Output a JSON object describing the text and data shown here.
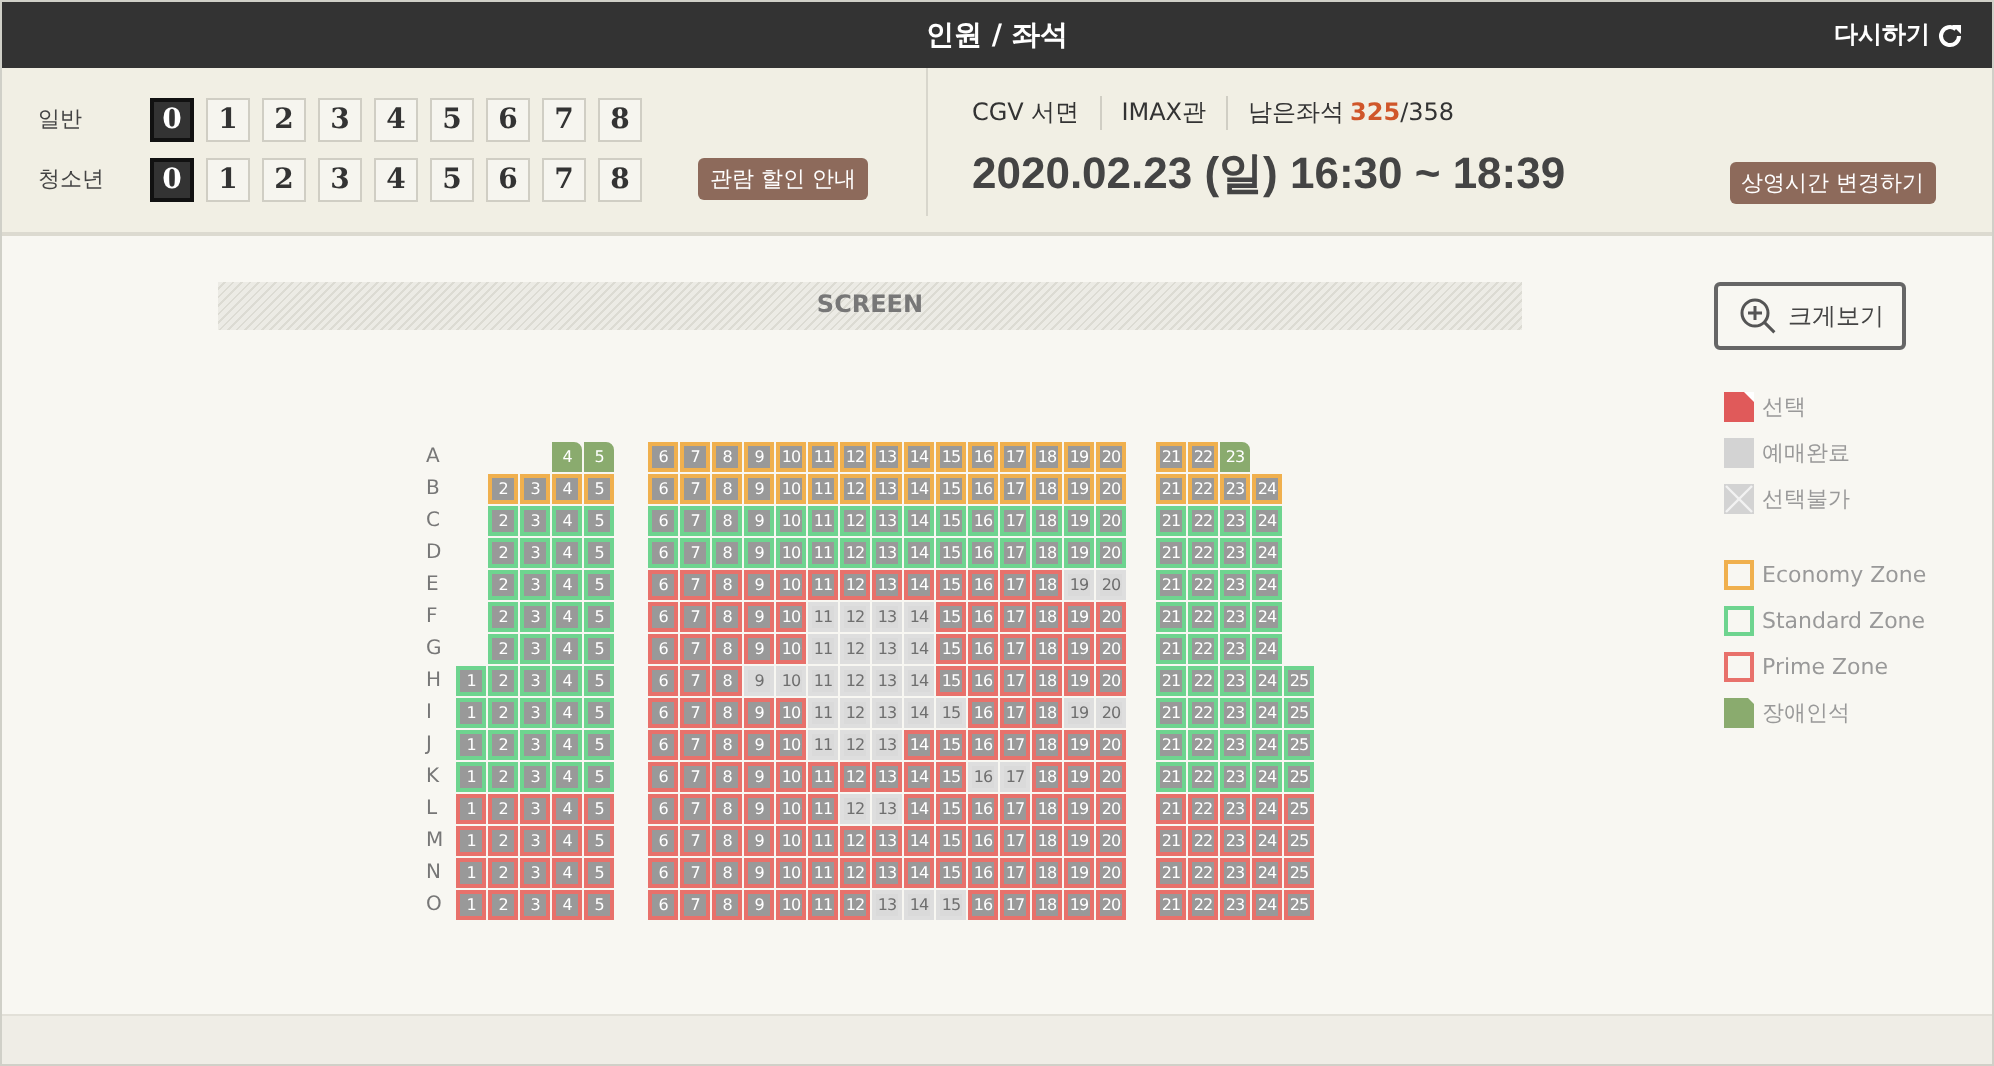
{
  "header": {
    "title": "인원 / 좌석",
    "reset_label": "다시하기"
  },
  "people": [
    {
      "label": "일반",
      "options": [
        {
          "label": "0",
          "selected": true
        },
        {
          "label": "1",
          "selected": false
        },
        {
          "label": "2",
          "selected": false
        },
        {
          "label": "3",
          "selected": false
        },
        {
          "label": "4",
          "selected": false
        },
        {
          "label": "5",
          "selected": false
        },
        {
          "label": "6",
          "selected": false
        },
        {
          "label": "7",
          "selected": false
        },
        {
          "label": "8",
          "selected": false
        }
      ]
    },
    {
      "label": "청소년",
      "options": [
        {
          "label": "0",
          "selected": true
        },
        {
          "label": "1",
          "selected": false
        },
        {
          "label": "2",
          "selected": false
        },
        {
          "label": "3",
          "selected": false
        },
        {
          "label": "4",
          "selected": false
        },
        {
          "label": "5",
          "selected": false
        },
        {
          "label": "6",
          "selected": false
        },
        {
          "label": "7",
          "selected": false
        },
        {
          "label": "8",
          "selected": false
        }
      ]
    }
  ],
  "discount_button": "관람 할인 안내",
  "showing": {
    "theater": "CGV 서면",
    "hall": "IMAX관",
    "remaining_label": "남은좌석",
    "remaining": "325",
    "total": "/358",
    "datetime": "2020.02.23 (일) 16:30 ~ 18:39",
    "change_button": "상영시간 변경하기"
  },
  "screen_label": "SCREEN",
  "zoom_button": "크게보기",
  "legend": [
    {
      "kind": "selected",
      "label": "선택"
    },
    {
      "kind": "sold",
      "label": "예매완료"
    },
    {
      "kind": "unavailable",
      "label": "선택불가"
    },
    {
      "kind": "economy",
      "label": "Economy Zone"
    },
    {
      "kind": "standard",
      "label": "Standard Zone"
    },
    {
      "kind": "prime",
      "label": "Prime Zone"
    },
    {
      "kind": "handicap",
      "label": "장애인석"
    }
  ],
  "rows": [
    {
      "label": "A",
      "blocks": [
        {
          "kind": "handicap",
          "seats": [
            {
              "number": "4",
              "sold": false
            },
            {
              "number": "5",
              "sold": false
            }
          ]
        },
        {
          "kind": "economy",
          "seats": [
            {
              "number": "6",
              "sold": false
            },
            {
              "number": "7",
              "sold": false
            },
            {
              "number": "8",
              "sold": false
            },
            {
              "number": "9",
              "sold": false
            },
            {
              "number": "10",
              "sold": false
            },
            {
              "number": "11",
              "sold": false
            },
            {
              "number": "12",
              "sold": false
            },
            {
              "number": "13",
              "sold": false
            },
            {
              "number": "14",
              "sold": false
            },
            {
              "number": "15",
              "sold": false
            },
            {
              "number": "16",
              "sold": false
            },
            {
              "number": "17",
              "sold": false
            },
            {
              "number": "18",
              "sold": false
            },
            {
              "number": "19",
              "sold": false
            },
            {
              "number": "20",
              "sold": false
            }
          ]
        },
        {
          "kind": "economy",
          "seats": [
            {
              "number": "21",
              "sold": false,
              "kind": "regular"
            },
            {
              "number": "22",
              "sold": false,
              "kind": "regular"
            },
            {
              "number": "23",
              "sold": false,
              "kind": "handicap"
            }
          ]
        }
      ]
    },
    {
      "label": "B",
      "blocks": [
        {
          "kind": "economy",
          "seats": [
            {
              "number": "2",
              "sold": false
            },
            {
              "number": "3",
              "sold": false
            },
            {
              "number": "4",
              "sold": false
            },
            {
              "number": "5",
              "sold": false
            }
          ]
        },
        {
          "kind": "economy",
          "seats": [
            {
              "number": "6",
              "sold": false
            },
            {
              "number": "7",
              "sold": false
            },
            {
              "number": "8",
              "sold": false
            },
            {
              "number": "9",
              "sold": false
            },
            {
              "number": "10",
              "sold": false
            },
            {
              "number": "11",
              "sold": false
            },
            {
              "number": "12",
              "sold": false
            },
            {
              "number": "13",
              "sold": false
            },
            {
              "number": "14",
              "sold": false
            },
            {
              "number": "15",
              "sold": false
            },
            {
              "number": "16",
              "sold": false
            },
            {
              "number": "17",
              "sold": false
            },
            {
              "number": "18",
              "sold": false
            },
            {
              "number": "19",
              "sold": false
            },
            {
              "number": "20",
              "sold": false
            }
          ]
        },
        {
          "kind": "economy",
          "seats": [
            {
              "number": "21",
              "sold": false
            },
            {
              "number": "22",
              "sold": false
            },
            {
              "number": "23",
              "sold": false
            },
            {
              "number": "24",
              "sold": false
            }
          ]
        }
      ]
    },
    {
      "label": "C",
      "blocks": [
        {
          "kind": "standard",
          "seats": [
            {
              "number": "2",
              "sold": false
            },
            {
              "number": "3",
              "sold": false
            },
            {
              "number": "4",
              "sold": false
            },
            {
              "number": "5",
              "sold": false
            }
          ]
        },
        {
          "kind": "standard",
          "seats": [
            {
              "number": "6",
              "sold": false
            },
            {
              "number": "7",
              "sold": false
            },
            {
              "number": "8",
              "sold": false
            },
            {
              "number": "9",
              "sold": false
            },
            {
              "number": "10",
              "sold": false
            },
            {
              "number": "11",
              "sold": false
            },
            {
              "number": "12",
              "sold": false
            },
            {
              "number": "13",
              "sold": false
            },
            {
              "number": "14",
              "sold": false
            },
            {
              "number": "15",
              "sold": false
            },
            {
              "number": "16",
              "sold": false
            },
            {
              "number": "17",
              "sold": false
            },
            {
              "number": "18",
              "sold": false
            },
            {
              "number": "19",
              "sold": false
            },
            {
              "number": "20",
              "sold": false
            }
          ]
        },
        {
          "kind": "standard",
          "seats": [
            {
              "number": "21",
              "sold": false
            },
            {
              "number": "22",
              "sold": false
            },
            {
              "number": "23",
              "sold": false
            },
            {
              "number": "24",
              "sold": false
            }
          ]
        }
      ]
    },
    {
      "label": "D",
      "blocks": [
        {
          "kind": "standard",
          "seats": [
            {
              "number": "2",
              "sold": false
            },
            {
              "number": "3",
              "sold": false
            },
            {
              "number": "4",
              "sold": false
            },
            {
              "number": "5",
              "sold": false
            }
          ]
        },
        {
          "kind": "standard",
          "seats": [
            {
              "number": "6",
              "sold": false
            },
            {
              "number": "7",
              "sold": false
            },
            {
              "number": "8",
              "sold": false
            },
            {
              "number": "9",
              "sold": false
            },
            {
              "number": "10",
              "sold": false
            },
            {
              "number": "11",
              "sold": false
            },
            {
              "number": "12",
              "sold": false
            },
            {
              "number": "13",
              "sold": false
            },
            {
              "number": "14",
              "sold": false
            },
            {
              "number": "15",
              "sold": false
            },
            {
              "number": "16",
              "sold": false
            },
            {
              "number": "17",
              "sold": false
            },
            {
              "number": "18",
              "sold": false
            },
            {
              "number": "19",
              "sold": false
            },
            {
              "number": "20",
              "sold": false
            }
          ]
        },
        {
          "kind": "standard",
          "seats": [
            {
              "number": "21",
              "sold": false
            },
            {
              "number": "22",
              "sold": false
            },
            {
              "number": "23",
              "sold": false
            },
            {
              "number": "24",
              "sold": false
            }
          ]
        }
      ]
    },
    {
      "label": "E",
      "blocks": [
        {
          "kind": "standard",
          "seats": [
            {
              "number": "2",
              "sold": false
            },
            {
              "number": "3",
              "sold": false
            },
            {
              "number": "4",
              "sold": false
            },
            {
              "number": "5",
              "sold": false
            }
          ]
        },
        {
          "kind": "prime",
          "seats": [
            {
              "number": "6",
              "sold": false
            },
            {
              "number": "7",
              "sold": false
            },
            {
              "number": "8",
              "sold": false
            },
            {
              "number": "9",
              "sold": false
            },
            {
              "number": "10",
              "sold": false
            },
            {
              "number": "11",
              "sold": false
            },
            {
              "number": "12",
              "sold": false
            },
            {
              "number": "13",
              "sold": false
            },
            {
              "number": "14",
              "sold": false
            },
            {
              "number": "15",
              "sold": false
            },
            {
              "number": "16",
              "sold": false
            },
            {
              "number": "17",
              "sold": false
            },
            {
              "number": "18",
              "sold": false
            },
            {
              "number": "19",
              "sold": true
            },
            {
              "number": "20",
              "sold": true
            }
          ]
        },
        {
          "kind": "standard",
          "seats": [
            {
              "number": "21",
              "sold": false
            },
            {
              "number": "22",
              "sold": false
            },
            {
              "number": "23",
              "sold": false
            },
            {
              "number": "24",
              "sold": false
            }
          ]
        }
      ]
    },
    {
      "label": "F",
      "blocks": [
        {
          "kind": "standard",
          "seats": [
            {
              "number": "2",
              "sold": false
            },
            {
              "number": "3",
              "sold": false
            },
            {
              "number": "4",
              "sold": false
            },
            {
              "number": "5",
              "sold": false
            }
          ]
        },
        {
          "kind": "prime",
          "seats": [
            {
              "number": "6",
              "sold": false
            },
            {
              "number": "7",
              "sold": false
            },
            {
              "number": "8",
              "sold": false
            },
            {
              "number": "9",
              "sold": false
            },
            {
              "number": "10",
              "sold": false
            },
            {
              "number": "11",
              "sold": true
            },
            {
              "number": "12",
              "sold": true
            },
            {
              "number": "13",
              "sold": true
            },
            {
              "number": "14",
              "sold": true
            },
            {
              "number": "15",
              "sold": false
            },
            {
              "number": "16",
              "sold": false
            },
            {
              "number": "17",
              "sold": false
            },
            {
              "number": "18",
              "sold": false
            },
            {
              "number": "19",
              "sold": false
            },
            {
              "number": "20",
              "sold": false
            }
          ]
        },
        {
          "kind": "standard",
          "seats": [
            {
              "number": "21",
              "sold": false
            },
            {
              "number": "22",
              "sold": false
            },
            {
              "number": "23",
              "sold": false
            },
            {
              "number": "24",
              "sold": false
            }
          ]
        }
      ]
    },
    {
      "label": "G",
      "blocks": [
        {
          "kind": "standard",
          "seats": [
            {
              "number": "2",
              "sold": false
            },
            {
              "number": "3",
              "sold": false
            },
            {
              "number": "4",
              "sold": false
            },
            {
              "number": "5",
              "sold": false
            }
          ]
        },
        {
          "kind": "prime",
          "seats": [
            {
              "number": "6",
              "sold": false
            },
            {
              "number": "7",
              "sold": false
            },
            {
              "number": "8",
              "sold": false
            },
            {
              "number": "9",
              "sold": false
            },
            {
              "number": "10",
              "sold": false
            },
            {
              "number": "11",
              "sold": true
            },
            {
              "number": "12",
              "sold": true
            },
            {
              "number": "13",
              "sold": true
            },
            {
              "number": "14",
              "sold": true
            },
            {
              "number": "15",
              "sold": false
            },
            {
              "number": "16",
              "sold": false
            },
            {
              "number": "17",
              "sold": false
            },
            {
              "number": "18",
              "sold": false
            },
            {
              "number": "19",
              "sold": false
            },
            {
              "number": "20",
              "sold": false
            }
          ]
        },
        {
          "kind": "standard",
          "seats": [
            {
              "number": "21",
              "sold": false
            },
            {
              "number": "22",
              "sold": false
            },
            {
              "number": "23",
              "sold": false
            },
            {
              "number": "24",
              "sold": false
            }
          ]
        }
      ]
    },
    {
      "label": "H",
      "blocks": [
        {
          "kind": "standard",
          "seats": [
            {
              "number": "1",
              "sold": false
            },
            {
              "number": "2",
              "sold": false
            },
            {
              "number": "3",
              "sold": false
            },
            {
              "number": "4",
              "sold": false
            },
            {
              "number": "5",
              "sold": false
            }
          ]
        },
        {
          "kind": "prime",
          "seats": [
            {
              "number": "6",
              "sold": false
            },
            {
              "number": "7",
              "sold": false
            },
            {
              "number": "8",
              "sold": false
            },
            {
              "number": "9",
              "sold": true
            },
            {
              "number": "10",
              "sold": true
            },
            {
              "number": "11",
              "sold": true
            },
            {
              "number": "12",
              "sold": true
            },
            {
              "number": "13",
              "sold": true
            },
            {
              "number": "14",
              "sold": true
            },
            {
              "number": "15",
              "sold": false
            },
            {
              "number": "16",
              "sold": false
            },
            {
              "number": "17",
              "sold": false
            },
            {
              "number": "18",
              "sold": false
            },
            {
              "number": "19",
              "sold": false
            },
            {
              "number": "20",
              "sold": false
            }
          ]
        },
        {
          "kind": "standard",
          "seats": [
            {
              "number": "21",
              "sold": false
            },
            {
              "number": "22",
              "sold": false
            },
            {
              "number": "23",
              "sold": false
            },
            {
              "number": "24",
              "sold": false
            },
            {
              "number": "25",
              "sold": false
            }
          ]
        }
      ]
    },
    {
      "label": "I",
      "blocks": [
        {
          "kind": "standard",
          "seats": [
            {
              "number": "1",
              "sold": false
            },
            {
              "number": "2",
              "sold": false
            },
            {
              "number": "3",
              "sold": false
            },
            {
              "number": "4",
              "sold": false
            },
            {
              "number": "5",
              "sold": false
            }
          ]
        },
        {
          "kind": "prime",
          "seats": [
            {
              "number": "6",
              "sold": false
            },
            {
              "number": "7",
              "sold": false
            },
            {
              "number": "8",
              "sold": false
            },
            {
              "number": "9",
              "sold": false
            },
            {
              "number": "10",
              "sold": false
            },
            {
              "number": "11",
              "sold": true
            },
            {
              "number": "12",
              "sold": true
            },
            {
              "number": "13",
              "sold": true
            },
            {
              "number": "14",
              "sold": true
            },
            {
              "number": "15",
              "sold": true
            },
            {
              "number": "16",
              "sold": false
            },
            {
              "number": "17",
              "sold": false
            },
            {
              "number": "18",
              "sold": false
            },
            {
              "number": "19",
              "sold": true
            },
            {
              "number": "20",
              "sold": true
            }
          ]
        },
        {
          "kind": "standard",
          "seats": [
            {
              "number": "21",
              "sold": false
            },
            {
              "number": "22",
              "sold": false
            },
            {
              "number": "23",
              "sold": false
            },
            {
              "number": "24",
              "sold": false
            },
            {
              "number": "25",
              "sold": false
            }
          ]
        }
      ]
    },
    {
      "label": "J",
      "blocks": [
        {
          "kind": "standard",
          "seats": [
            {
              "number": "1",
              "sold": false
            },
            {
              "number": "2",
              "sold": false
            },
            {
              "number": "3",
              "sold": false
            },
            {
              "number": "4",
              "sold": false
            },
            {
              "number": "5",
              "sold": false
            }
          ]
        },
        {
          "kind": "prime",
          "seats": [
            {
              "number": "6",
              "sold": false
            },
            {
              "number": "7",
              "sold": false
            },
            {
              "number": "8",
              "sold": false
            },
            {
              "number": "9",
              "sold": false
            },
            {
              "number": "10",
              "sold": false
            },
            {
              "number": "11",
              "sold": true
            },
            {
              "number": "12",
              "sold": true
            },
            {
              "number": "13",
              "sold": true
            },
            {
              "number": "14",
              "sold": false
            },
            {
              "number": "15",
              "sold": false
            },
            {
              "number": "16",
              "sold": false
            },
            {
              "number": "17",
              "sold": false
            },
            {
              "number": "18",
              "sold": false
            },
            {
              "number": "19",
              "sold": false
            },
            {
              "number": "20",
              "sold": false
            }
          ]
        },
        {
          "kind": "standard",
          "seats": [
            {
              "number": "21",
              "sold": false
            },
            {
              "number": "22",
              "sold": false
            },
            {
              "number": "23",
              "sold": false
            },
            {
              "number": "24",
              "sold": false
            },
            {
              "number": "25",
              "sold": false
            }
          ]
        }
      ]
    },
    {
      "label": "K",
      "blocks": [
        {
          "kind": "standard",
          "seats": [
            {
              "number": "1",
              "sold": false
            },
            {
              "number": "2",
              "sold": false
            },
            {
              "number": "3",
              "sold": false
            },
            {
              "number": "4",
              "sold": false
            },
            {
              "number": "5",
              "sold": false
            }
          ]
        },
        {
          "kind": "prime",
          "seats": [
            {
              "number": "6",
              "sold": false
            },
            {
              "number": "7",
              "sold": false
            },
            {
              "number": "8",
              "sold": false
            },
            {
              "number": "9",
              "sold": false
            },
            {
              "number": "10",
              "sold": false
            },
            {
              "number": "11",
              "sold": false
            },
            {
              "number": "12",
              "sold": false
            },
            {
              "number": "13",
              "sold": false
            },
            {
              "number": "14",
              "sold": false
            },
            {
              "number": "15",
              "sold": false
            },
            {
              "number": "16",
              "sold": true
            },
            {
              "number": "17",
              "sold": true
            },
            {
              "number": "18",
              "sold": false
            },
            {
              "number": "19",
              "sold": false
            },
            {
              "number": "20",
              "sold": false
            }
          ]
        },
        {
          "kind": "standard",
          "seats": [
            {
              "number": "21",
              "sold": false
            },
            {
              "number": "22",
              "sold": false
            },
            {
              "number": "23",
              "sold": false
            },
            {
              "number": "24",
              "sold": false
            },
            {
              "number": "25",
              "sold": false
            }
          ]
        }
      ]
    },
    {
      "label": "L",
      "blocks": [
        {
          "kind": "prime",
          "seats": [
            {
              "number": "1",
              "sold": false
            },
            {
              "number": "2",
              "sold": false
            },
            {
              "number": "3",
              "sold": false
            },
            {
              "number": "4",
              "sold": false
            },
            {
              "number": "5",
              "sold": false
            }
          ]
        },
        {
          "kind": "prime",
          "seats": [
            {
              "number": "6",
              "sold": false
            },
            {
              "number": "7",
              "sold": false
            },
            {
              "number": "8",
              "sold": false
            },
            {
              "number": "9",
              "sold": false
            },
            {
              "number": "10",
              "sold": false
            },
            {
              "number": "11",
              "sold": false
            },
            {
              "number": "12",
              "sold": true
            },
            {
              "number": "13",
              "sold": true
            },
            {
              "number": "14",
              "sold": false
            },
            {
              "number": "15",
              "sold": false
            },
            {
              "number": "16",
              "sold": false
            },
            {
              "number": "17",
              "sold": false
            },
            {
              "number": "18",
              "sold": false
            },
            {
              "number": "19",
              "sold": false
            },
            {
              "number": "20",
              "sold": false
            }
          ]
        },
        {
          "kind": "prime",
          "seats": [
            {
              "number": "21",
              "sold": false
            },
            {
              "number": "22",
              "sold": false
            },
            {
              "number": "23",
              "sold": false
            },
            {
              "number": "24",
              "sold": false
            },
            {
              "number": "25",
              "sold": false
            }
          ]
        }
      ]
    },
    {
      "label": "M",
      "blocks": [
        {
          "kind": "prime",
          "seats": [
            {
              "number": "1",
              "sold": false
            },
            {
              "number": "2",
              "sold": false
            },
            {
              "number": "3",
              "sold": false
            },
            {
              "number": "4",
              "sold": false
            },
            {
              "number": "5",
              "sold": false
            }
          ]
        },
        {
          "kind": "prime",
          "seats": [
            {
              "number": "6",
              "sold": false
            },
            {
              "number": "7",
              "sold": false
            },
            {
              "number": "8",
              "sold": false
            },
            {
              "number": "9",
              "sold": false
            },
            {
              "number": "10",
              "sold": false
            },
            {
              "number": "11",
              "sold": false
            },
            {
              "number": "12",
              "sold": false
            },
            {
              "number": "13",
              "sold": false
            },
            {
              "number": "14",
              "sold": false
            },
            {
              "number": "15",
              "sold": false
            },
            {
              "number": "16",
              "sold": false
            },
            {
              "number": "17",
              "sold": false
            },
            {
              "number": "18",
              "sold": false
            },
            {
              "number": "19",
              "sold": false
            },
            {
              "number": "20",
              "sold": false
            }
          ]
        },
        {
          "kind": "prime",
          "seats": [
            {
              "number": "21",
              "sold": false
            },
            {
              "number": "22",
              "sold": false
            },
            {
              "number": "23",
              "sold": false
            },
            {
              "number": "24",
              "sold": false
            },
            {
              "number": "25",
              "sold": false
            }
          ]
        }
      ]
    },
    {
      "label": "N",
      "blocks": [
        {
          "kind": "prime",
          "seats": [
            {
              "number": "1",
              "sold": false
            },
            {
              "number": "2",
              "sold": false
            },
            {
              "number": "3",
              "sold": false
            },
            {
              "number": "4",
              "sold": false
            },
            {
              "number": "5",
              "sold": false
            }
          ]
        },
        {
          "kind": "prime",
          "seats": [
            {
              "number": "6",
              "sold": false
            },
            {
              "number": "7",
              "sold": false
            },
            {
              "number": "8",
              "sold": false
            },
            {
              "number": "9",
              "sold": false
            },
            {
              "number": "10",
              "sold": false
            },
            {
              "number": "11",
              "sold": false
            },
            {
              "number": "12",
              "sold": false
            },
            {
              "number": "13",
              "sold": false
            },
            {
              "number": "14",
              "sold": false
            },
            {
              "number": "15",
              "sold": false
            },
            {
              "number": "16",
              "sold": false
            },
            {
              "number": "17",
              "sold": false
            },
            {
              "number": "18",
              "sold": false
            },
            {
              "number": "19",
              "sold": false
            },
            {
              "number": "20",
              "sold": false
            }
          ]
        },
        {
          "kind": "prime",
          "seats": [
            {
              "number": "21",
              "sold": false
            },
            {
              "number": "22",
              "sold": false
            },
            {
              "number": "23",
              "sold": false
            },
            {
              "number": "24",
              "sold": false
            },
            {
              "number": "25",
              "sold": false
            }
          ]
        }
      ]
    },
    {
      "label": "O",
      "blocks": [
        {
          "kind": "prime",
          "seats": [
            {
              "number": "1",
              "sold": false
            },
            {
              "number": "2",
              "sold": false
            },
            {
              "number": "3",
              "sold": false
            },
            {
              "number": "4",
              "sold": false
            },
            {
              "number": "5",
              "sold": false
            }
          ]
        },
        {
          "kind": "prime",
          "seats": [
            {
              "number": "6",
              "sold": false
            },
            {
              "number": "7",
              "sold": false
            },
            {
              "number": "8",
              "sold": false
            },
            {
              "number": "9",
              "sold": false
            },
            {
              "number": "10",
              "sold": false
            },
            {
              "number": "11",
              "sold": false
            },
            {
              "number": "12",
              "sold": false
            },
            {
              "number": "13",
              "sold": true
            },
            {
              "number": "14",
              "sold": true
            },
            {
              "number": "15",
              "sold": true
            },
            {
              "number": "16",
              "sold": false
            },
            {
              "number": "17",
              "sold": false
            },
            {
              "number": "18",
              "sold": false
            },
            {
              "number": "19",
              "sold": false
            },
            {
              "number": "20",
              "sold": false
            }
          ]
        },
        {
          "kind": "prime",
          "seats": [
            {
              "number": "21",
              "sold": false
            },
            {
              "number": "22",
              "sold": false
            },
            {
              "number": "23",
              "sold": false
            },
            {
              "number": "24",
              "sold": false
            },
            {
              "number": "25",
              "sold": false
            }
          ]
        }
      ]
    }
  ]
}
